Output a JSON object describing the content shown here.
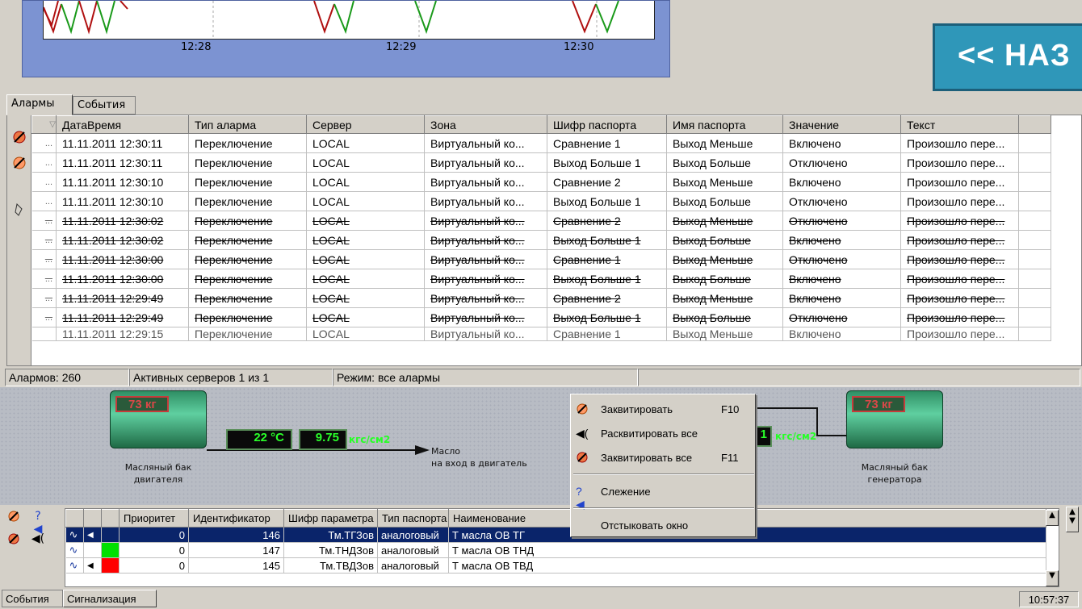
{
  "chart": {
    "ticks": [
      "12:28",
      "12:29",
      "12:30"
    ],
    "back_button": "<< НАЗ"
  },
  "tabs": [
    {
      "label": "Алармы",
      "active": true
    },
    {
      "label": "События",
      "active": false
    }
  ],
  "alarm_table": {
    "columns": [
      "",
      "ДатаВремя",
      "Тип аларма",
      "Сервер",
      "Зона",
      "Шифр паспорта",
      "Имя паспорта",
      "Значение",
      "Текст"
    ],
    "rows": [
      {
        "marker": "...",
        "dt": "11.11.2011 12:30:11",
        "type": "Переключение",
        "server": "LOCAL",
        "zone": "Виртуальный ко...",
        "code": "Сравнение 1",
        "name": "Выход Меньше",
        "value": "Включено",
        "text": "Произошло пере...",
        "acked": false
      },
      {
        "marker": "...",
        "dt": "11.11.2011 12:30:11",
        "type": "Переключение",
        "server": "LOCAL",
        "zone": "Виртуальный ко...",
        "code": "Выход Больше 1",
        "name": "Выход Больше",
        "value": "Отключено",
        "text": "Произошло пере...",
        "acked": false
      },
      {
        "marker": "...",
        "dt": "11.11.2011 12:30:10",
        "type": "Переключение",
        "server": "LOCAL",
        "zone": "Виртуальный ко...",
        "code": "Сравнение 2",
        "name": "Выход Меньше",
        "value": "Включено",
        "text": "Произошло пере...",
        "acked": false
      },
      {
        "marker": "...",
        "dt": "11.11.2011 12:30:10",
        "type": "Переключение",
        "server": "LOCAL",
        "zone": "Виртуальный ко...",
        "code": "Выход Больше 1",
        "name": "Выход Больше",
        "value": "Отключено",
        "text": "Произошло пере...",
        "acked": false
      },
      {
        "marker": "...",
        "dt": "11.11.2011 12:30:02",
        "type": "Переключение",
        "server": "LOCAL",
        "zone": "Виртуальный ко...",
        "code": "Сравнение 2",
        "name": "Выход Меньше",
        "value": "Отключено",
        "text": "Произошло пере...",
        "acked": true
      },
      {
        "marker": "...",
        "dt": "11.11.2011 12:30:02",
        "type": "Переключение",
        "server": "LOCAL",
        "zone": "Виртуальный ко...",
        "code": "Выход Больше 1",
        "name": "Выход Больше",
        "value": "Включено",
        "text": "Произошло пере...",
        "acked": true
      },
      {
        "marker": "...",
        "dt": "11.11.2011 12:30:00",
        "type": "Переключение",
        "server": "LOCAL",
        "zone": "Виртуальный ко...",
        "code": "Сравнение 1",
        "name": "Выход Меньше",
        "value": "Отключено",
        "text": "Произошло пере...",
        "acked": true
      },
      {
        "marker": "...",
        "dt": "11.11.2011 12:30:00",
        "type": "Переключение",
        "server": "LOCAL",
        "zone": "Виртуальный ко...",
        "code": "Выход Больше 1",
        "name": "Выход Больше",
        "value": "Включено",
        "text": "Произошло пере...",
        "acked": true
      },
      {
        "marker": "...",
        "dt": "11.11.2011 12:29:49",
        "type": "Переключение",
        "server": "LOCAL",
        "zone": "Виртуальный ко...",
        "code": "Сравнение 2",
        "name": "Выход Меньше",
        "value": "Включено",
        "text": "Произошло пере...",
        "acked": true
      },
      {
        "marker": "...",
        "dt": "11.11.2011 12:29:49",
        "type": "Переключение",
        "server": "LOCAL",
        "zone": "Виртуальный ко...",
        "code": "Выход Больше 1",
        "name": "Выход Больше",
        "value": "Отключено",
        "text": "Произошло пере...",
        "acked": true
      },
      {
        "marker": "",
        "dt": "11.11.2011 12:29:15",
        "type": "Переключение",
        "server": "LOCAL",
        "zone": "Виртуальный ко...",
        "code": "Сравнение 1",
        "name": "Выход Меньше",
        "value": "Включено",
        "text": "Произошло пере...",
        "acked": false
      }
    ]
  },
  "status": {
    "alarms": "Алармов: 260",
    "servers": "Активных серверов 1 из 1",
    "mode": "Режим: все алармы"
  },
  "diagram": {
    "tank_left": {
      "value": "73 кг",
      "label1": "Масляный бак",
      "label2": "двигателя"
    },
    "tank_right": {
      "value": "73 кг",
      "label1": "Масляный бак",
      "label2": "генератора"
    },
    "temp": "22 °C",
    "pressure": "9.75",
    "pressure_unit": "кгс/см2",
    "pressure_right": "1",
    "pressure_right_unit": "кгс/см2",
    "flow_label1": "Масло",
    "flow_label2": "на вход в двигатель"
  },
  "context_menu": {
    "items": [
      {
        "label": "Заквитировать",
        "key": "F10"
      },
      {
        "label": "Расквитировать все",
        "key": ""
      },
      {
        "label": "Заквитировать все",
        "key": "F11"
      },
      {
        "label": "Слежение",
        "key": ""
      },
      {
        "label": "Отстыковать окно",
        "key": ""
      }
    ]
  },
  "signal_table": {
    "columns": [
      "",
      "",
      "",
      "Приоритет",
      "Идентификатор",
      "Шифр параметра",
      "Тип паспорта",
      "Наименование"
    ],
    "rows": [
      {
        "priority": "0",
        "id": "146",
        "code": "Тм.ТГЗов",
        "type": "аналоговый",
        "name": "Т масла ОВ ТГ",
        "color": "#0a246a"
      },
      {
        "priority": "0",
        "id": "147",
        "code": "Тм.ТНДЗов",
        "type": "аналоговый",
        "name": "Т масла ОВ ТНД",
        "color": "#00e000"
      },
      {
        "priority": "0",
        "id": "145",
        "code": "Тм.ТВДЗов",
        "type": "аналоговый",
        "name": "Т масла ОВ ТВД",
        "color": "#ff0000"
      }
    ]
  },
  "bottom_tabs": [
    {
      "label": "События",
      "active": false
    },
    {
      "label": "Сигнализация",
      "active": true
    }
  ],
  "clock": "10:57:37",
  "colors": {
    "chart_bg": "#7c93d2",
    "back_button": "#2f97b9",
    "selection": "#0a246a"
  }
}
